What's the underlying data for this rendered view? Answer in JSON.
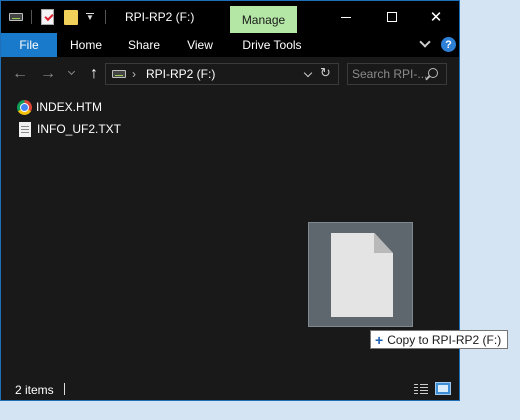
{
  "window": {
    "title": "RPI-RP2 (F:)",
    "context_tab": "Manage",
    "controls": {
      "minimize": "minimize-icon",
      "maximize": "maximize-icon",
      "close": "close-icon"
    }
  },
  "ribbon": {
    "tabs": [
      "File",
      "Home",
      "Share",
      "View",
      "Drive Tools"
    ],
    "help_label": "?"
  },
  "navigation": {
    "back_glyph": "←",
    "forward_glyph": "→",
    "up_glyph": "↑",
    "breadcrumb_separator": "›",
    "address": "RPI-RP2 (F:)",
    "refresh_glyph": "↻",
    "search_placeholder": "Search RPI-..."
  },
  "files": [
    {
      "name": "INDEX.HTM",
      "icon": "chrome-icon"
    },
    {
      "name": "INFO_UF2.TXT",
      "icon": "text-file-icon"
    }
  ],
  "drag": {
    "tooltip_plus": "+",
    "tooltip_text": "Copy to RPI-RP2 (F:)"
  },
  "status": {
    "item_count": "2 items"
  },
  "colors": {
    "background": "#191919",
    "file_tab": "#1979ca",
    "manage_tab": "#b4e7a5",
    "window_border": "#1f6fb8"
  }
}
